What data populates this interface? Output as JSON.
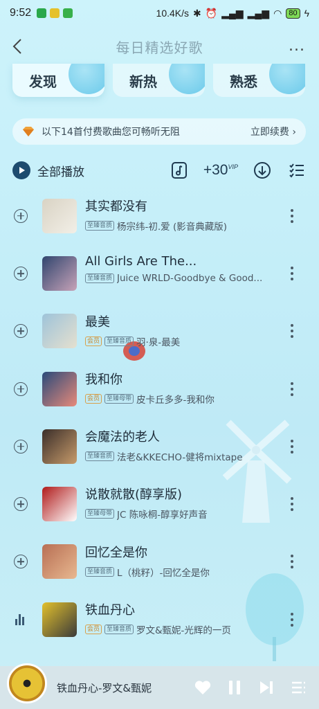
{
  "status_bar": {
    "time": "9:52",
    "network_speed": "10.4K/s",
    "battery": "80"
  },
  "header": {
    "title": "每日精选好歌",
    "more": "..."
  },
  "tabs": [
    {
      "label": "发现",
      "active": true
    },
    {
      "label": "新热",
      "active": false
    },
    {
      "label": "熟悉",
      "active": false
    }
  ],
  "vip_banner": {
    "text": "以下14首付费歌曲您可畅听无阻",
    "action": "立即续费 ›"
  },
  "toolbar": {
    "play_all": "全部播放",
    "plus30": "+30",
    "plus30_sup": "VIP"
  },
  "songs": [
    {
      "title": "其实都没有",
      "tags": [
        "至臻音质"
      ],
      "artist": "杨宗纬-初.爱 (影音典藏版)",
      "cover": [
        "#d9d3c4",
        "#f2efe7"
      ]
    },
    {
      "title": "All Girls Are The...",
      "tags": [
        "至臻音质"
      ],
      "artist": "Juice WRLD-Goodbye & Good...",
      "cover": [
        "#30456e",
        "#c7a3b8"
      ]
    },
    {
      "title": "最美",
      "tags": [
        "会员",
        "至臻音质"
      ],
      "artist": "羽·泉-最美",
      "cover": [
        "#9ec3d9",
        "#e5e0cf"
      ]
    },
    {
      "title": "我和你",
      "tags": [
        "会员",
        "至臻母带"
      ],
      "artist": "皮卡丘多多-我和你",
      "cover": [
        "#2a4a7a",
        "#e88a7a"
      ]
    },
    {
      "title": "会魔法的老人",
      "tags": [
        "至臻音质"
      ],
      "artist": "法老&KKECHO-健将mixtape",
      "cover": [
        "#3a2e2a",
        "#c79b6a"
      ]
    },
    {
      "title": "说散就散(醇享版)",
      "tags": [
        "至臻母带"
      ],
      "artist": "JC 陈咏桐-醇享好声音",
      "cover": [
        "#b01a1a",
        "#ffffff"
      ]
    },
    {
      "title": "回忆全是你",
      "tags": [
        "至臻音质"
      ],
      "artist": "L（桃籽）-回忆全是你",
      "cover": [
        "#b86f54",
        "#e8b890"
      ]
    },
    {
      "title": "铁血丹心",
      "tags": [
        "会员",
        "至臻音质"
      ],
      "artist": "罗文&甄妮-光辉的一页",
      "cover": [
        "#e2c02c",
        "#3a3a3a"
      ],
      "playing": true
    }
  ],
  "player": {
    "now_playing": "铁血丹心-罗文&甄妮"
  },
  "colors": {
    "accent": "#1d4b6e",
    "vip_gold": "#c98a2f",
    "background": "#c6eff9"
  }
}
